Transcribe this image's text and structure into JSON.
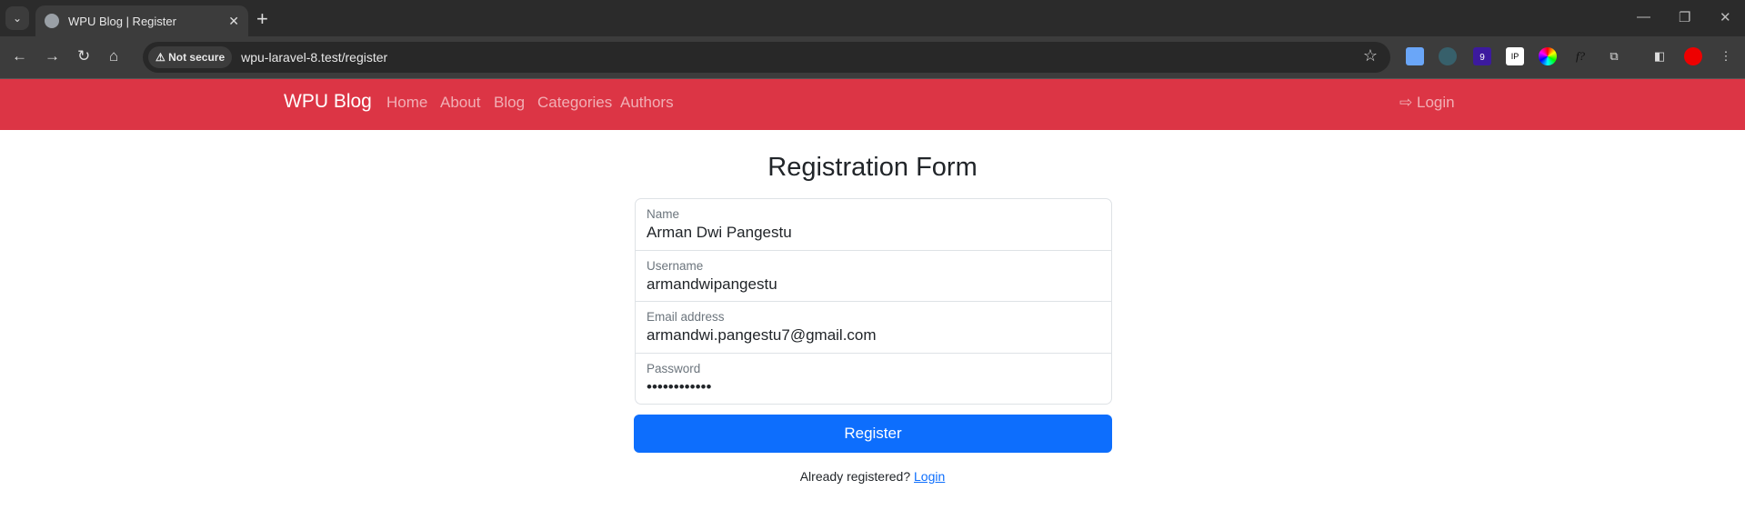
{
  "browser": {
    "tab_title": "WPU Blog | Register",
    "security_label": "Not secure",
    "url": "wpu-laravel-8.test/register",
    "extension_badge": "9",
    "ext_f_label": "f?"
  },
  "navbar": {
    "brand": "WPU Blog",
    "links": [
      "Home",
      "About",
      "Blog",
      "Categories",
      "Authors"
    ],
    "login": "Login",
    "color": "#dc3545"
  },
  "page": {
    "title": "Registration Form",
    "fields": [
      {
        "label": "Name",
        "value": "Arman Dwi Pangestu"
      },
      {
        "label": "Username",
        "value": "armandwipangestu"
      },
      {
        "label": "Email address",
        "value": "armandwi.pangestu7@gmail.com"
      },
      {
        "label": "Password",
        "value": "••••••••••••"
      }
    ],
    "submit": "Register",
    "footer_text": "Already registered?",
    "footer_link": "Login",
    "accent": "#0d6efd"
  }
}
